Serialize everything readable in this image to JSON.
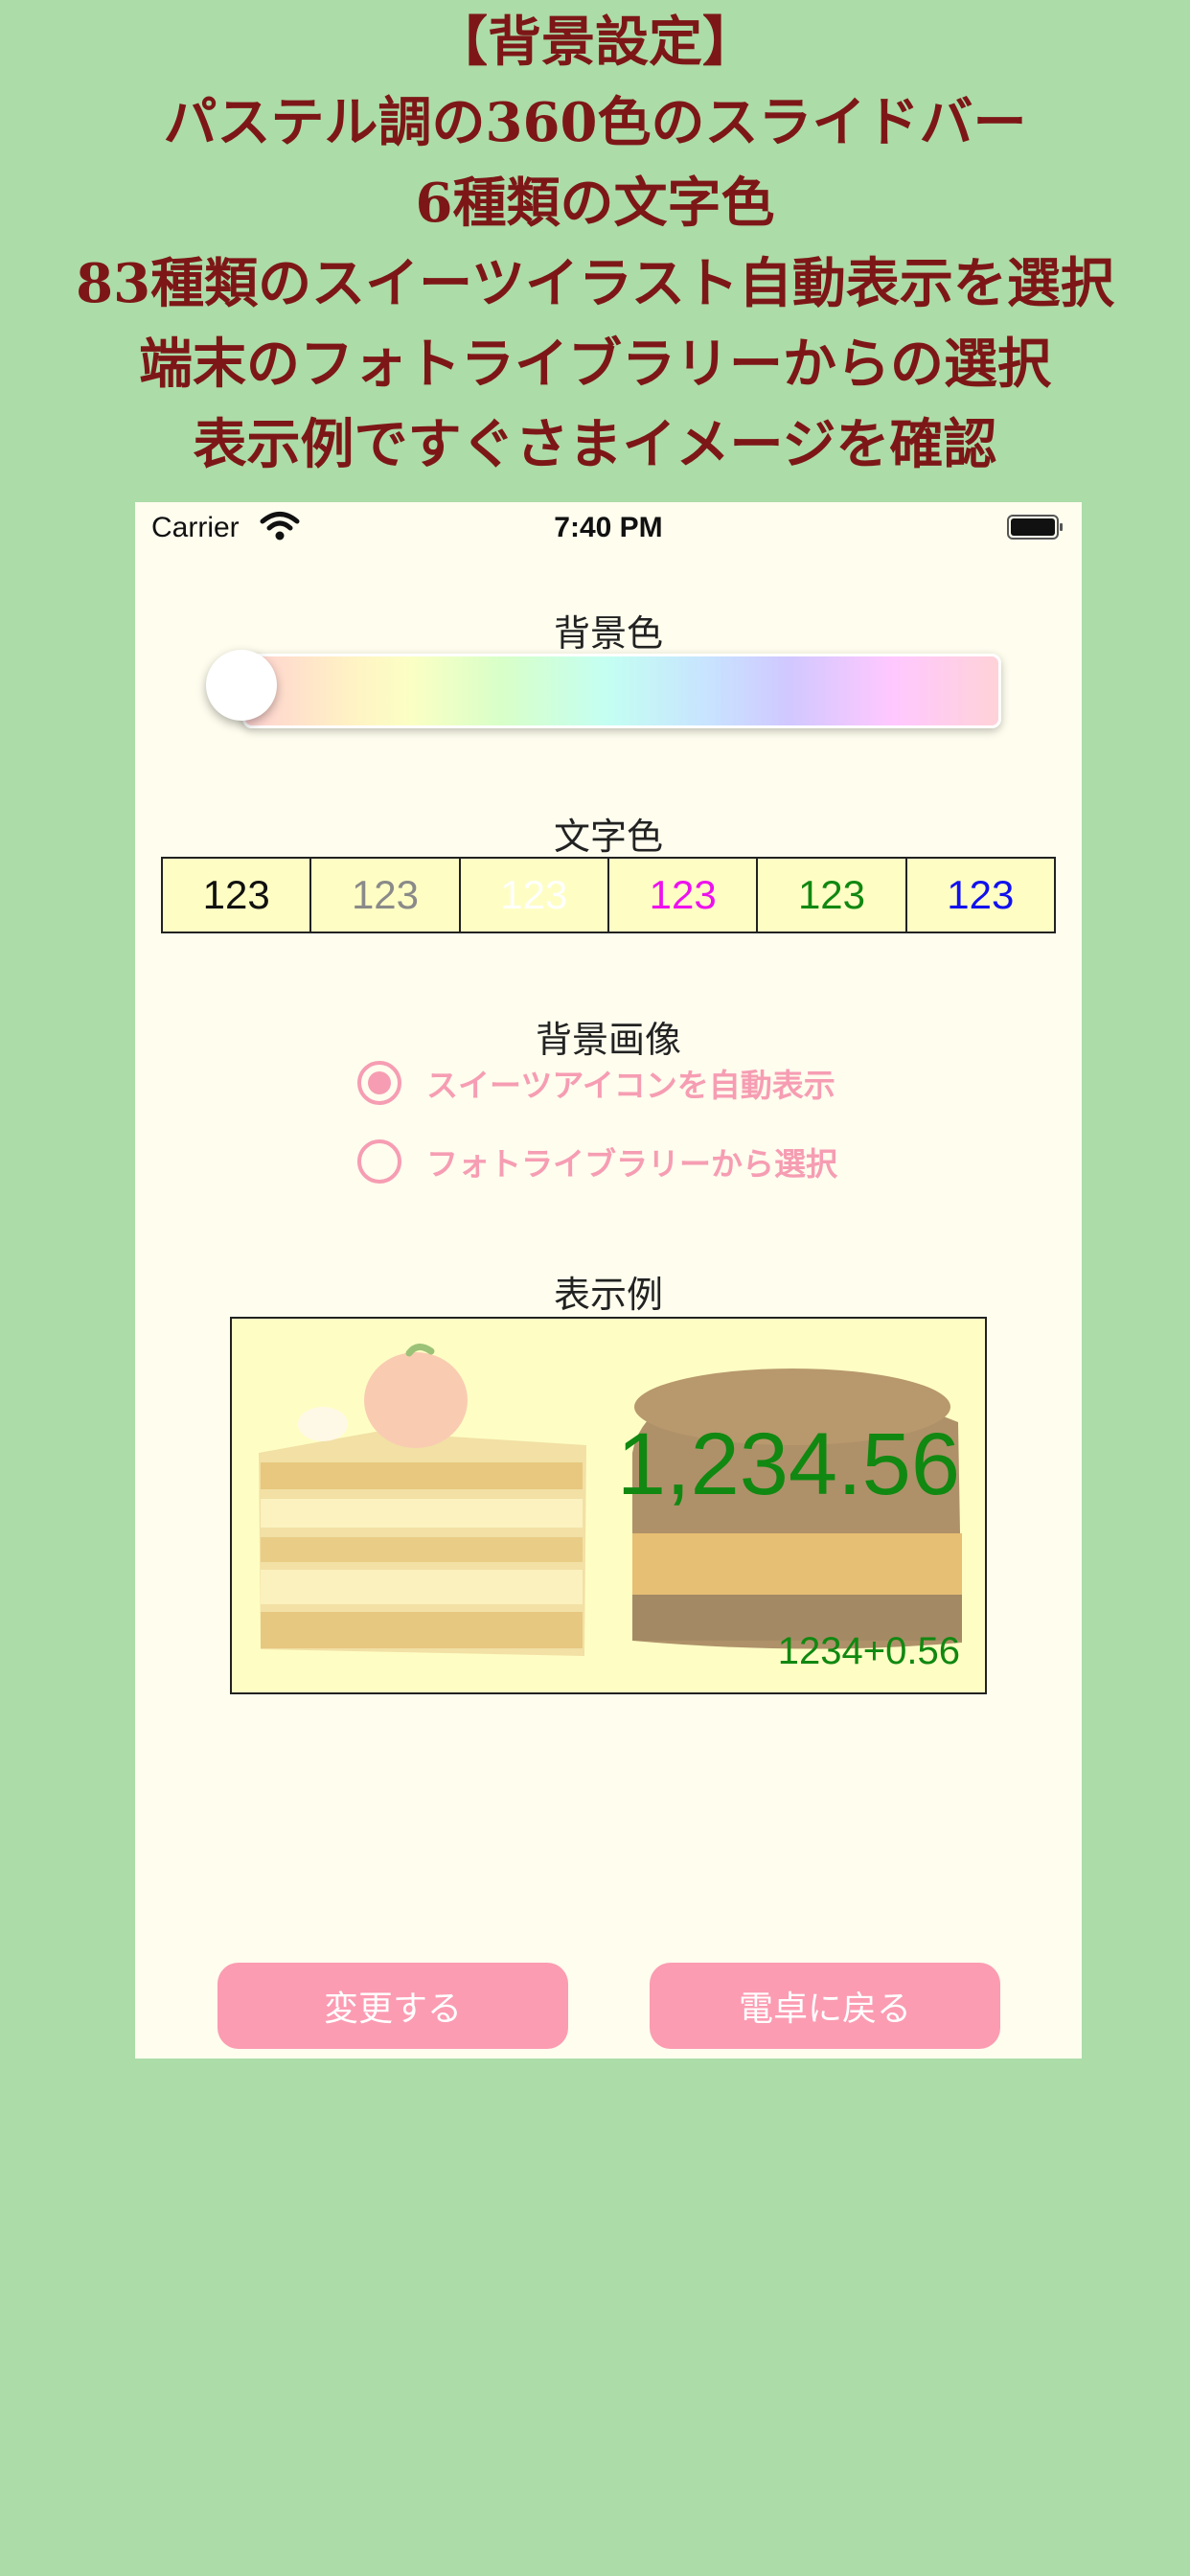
{
  "promo": {
    "lines": [
      "【背景設定】",
      "パステル調の360色のスライドバー",
      "6種類の文字色",
      "83種類のスイーツイラスト自動表示を選択",
      "端末のフォトライブラリーからの選択",
      "表示例ですぐさまイメージを確認"
    ]
  },
  "status_bar": {
    "carrier": "Carrier",
    "time": "7:40 PM",
    "icons": [
      "wifi-icon",
      "battery-icon"
    ]
  },
  "background_color": {
    "label": "背景色",
    "slider_value_fraction": 0.0
  },
  "text_color": {
    "label": "文字色",
    "options": [
      {
        "text": "123",
        "color": "#111111"
      },
      {
        "text": "123",
        "color": "#8a8a8a"
      },
      {
        "text": "123",
        "color": "#ffffff"
      },
      {
        "text": "123",
        "color": "#ee11ee"
      },
      {
        "text": "123",
        "color": "#118811"
      },
      {
        "text": "123",
        "color": "#1111ee"
      }
    ]
  },
  "background_image": {
    "label": "背景画像",
    "options": [
      {
        "label": "スイーツアイコンを自動表示",
        "selected": true
      },
      {
        "label": "フォトライブラリーから選択",
        "selected": false
      }
    ]
  },
  "preview": {
    "label": "表示例",
    "main_value": "1,234.56",
    "expression": "1234+0.56",
    "text_color": "#118811"
  },
  "buttons": {
    "change": "変更する",
    "back": "電卓に戻る"
  },
  "colors": {
    "page_background": "#acdca8",
    "promo_text": "#7d1717",
    "accent_pink": "#fb9cb2",
    "panel_background": "#fefdee"
  }
}
